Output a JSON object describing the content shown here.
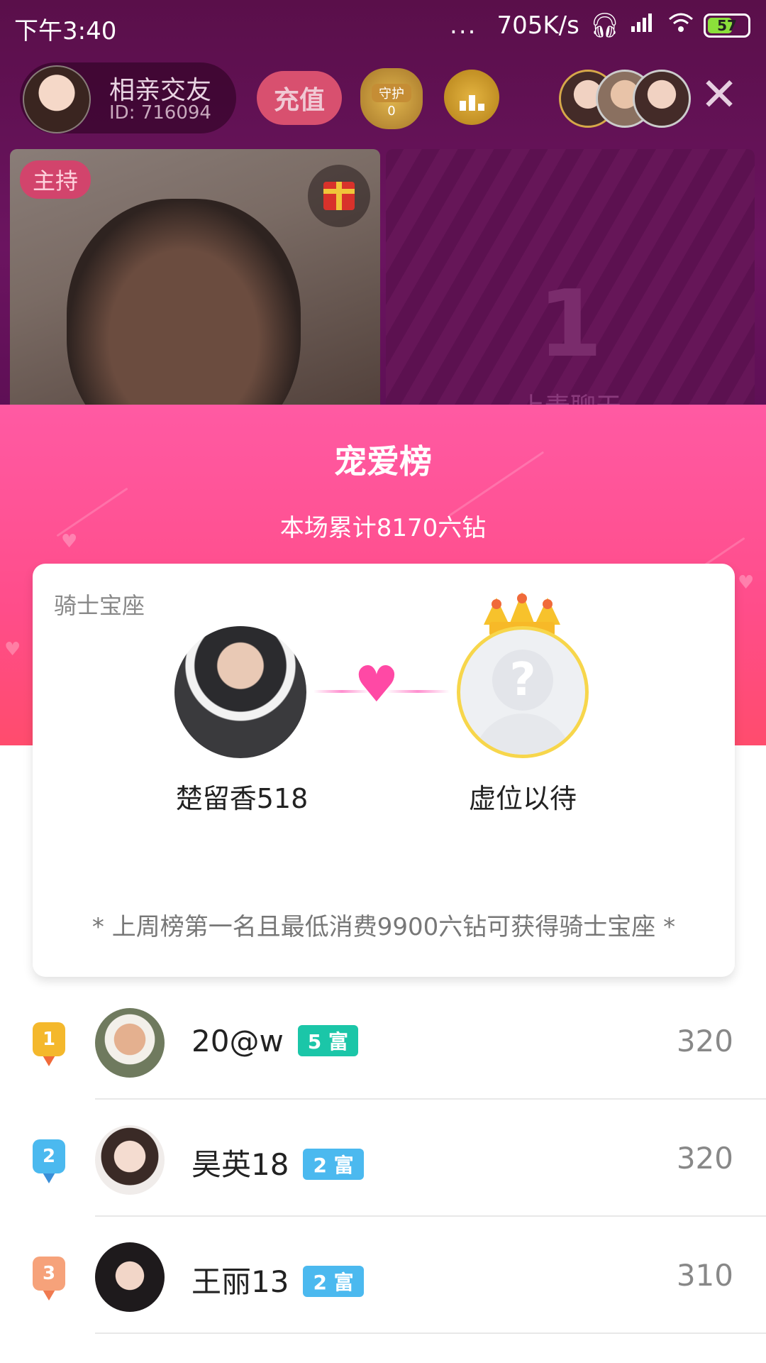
{
  "status_bar": {
    "time": "下午3:40",
    "dots": "...",
    "net_speed": "705K/s",
    "battery": "57"
  },
  "room": {
    "name": "相亲交友",
    "id": "ID: 716094",
    "recharge_label": "充值",
    "guard_label": "守护",
    "guard_count": "0",
    "close_glyph": "✕"
  },
  "host_video": {
    "tag": "主持"
  },
  "seat": {
    "number": "1",
    "label": "上麦聊天"
  },
  "sheet": {
    "title": "宠爱榜",
    "total": "本场累计8170六钻"
  },
  "throne": {
    "title": "骑士宝座",
    "knight_name": "楚留香518",
    "vacant_name": "虚位以待",
    "vacant_glyph": "?",
    "note": "* 上周榜第一名且最低消费9900六钻可获得骑士宝座 *"
  },
  "ranking": [
    {
      "rank": "1",
      "name": "20@w",
      "badge": "5 富",
      "badge_color": "#1bc6a8",
      "score": "320",
      "medal_color": "#f4b82c",
      "medal_tail": "#f06a3a"
    },
    {
      "rank": "2",
      "name": "昊英18",
      "badge": "2 富",
      "badge_color": "#4bb9ef",
      "score": "320",
      "medal_color": "#4bb9ef",
      "medal_tail": "#3a8fd8"
    },
    {
      "rank": "3",
      "name": "王丽13",
      "badge": "2 富",
      "badge_color": "#4bb9ef",
      "score": "310",
      "medal_color": "#f6a27a",
      "medal_tail": "#f07a50"
    }
  ],
  "colors": {
    "accent_pink": "#ff4d8a",
    "header_top": "#ff5aa3"
  }
}
